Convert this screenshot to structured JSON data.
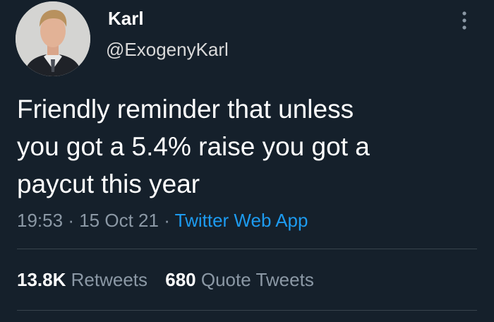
{
  "author": {
    "display_name": "Karl",
    "handle": "@ExogenyKarl"
  },
  "tweet": {
    "text": "Friendly reminder that unless\nyou got a 5.4% raise you got a\npaycut this year",
    "time": "19:53",
    "date": "15 Oct 21",
    "source": "Twitter Web App",
    "separator": "·"
  },
  "stats": [
    {
      "count": "13.8K",
      "label": "Retweets"
    },
    {
      "count": "680",
      "label": "Quote Tweets"
    }
  ],
  "icons": {
    "more": "more-vertical-icon",
    "avatar": "avatar"
  },
  "colors": {
    "background": "#15202b",
    "text": "#ffffff",
    "secondary_text": "#8b98a5",
    "link": "#1d9bf0",
    "divider": "#38444d"
  }
}
